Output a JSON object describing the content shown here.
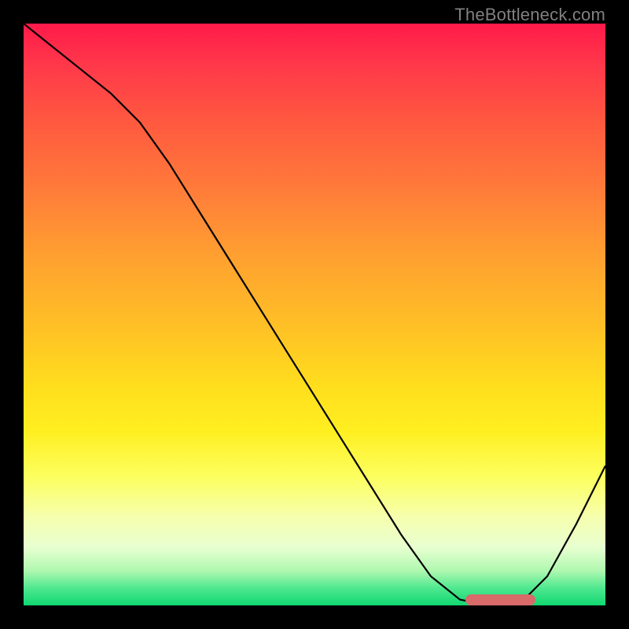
{
  "watermark": "TheBottleneck.com",
  "chart_data": {
    "type": "line",
    "title": "",
    "xlabel": "",
    "ylabel": "",
    "xlim": [
      0,
      100
    ],
    "ylim": [
      0,
      100
    ],
    "series": [
      {
        "name": "bottleneck-curve",
        "x": [
          0,
          5,
          10,
          15,
          20,
          25,
          30,
          35,
          40,
          45,
          50,
          55,
          60,
          65,
          70,
          75,
          80,
          85,
          90,
          95,
          100
        ],
        "y": [
          100,
          96,
          92,
          88,
          83,
          76,
          68,
          60,
          52,
          44,
          36,
          28,
          20,
          12,
          5,
          1,
          0,
          0,
          5,
          14,
          24
        ]
      }
    ],
    "optimal_range": {
      "x_start": 76,
      "x_end": 88,
      "y": 1
    },
    "background_gradient": {
      "top": "#ff1a4a",
      "mid": "#ffdd1e",
      "bottom": "#10d870"
    }
  }
}
